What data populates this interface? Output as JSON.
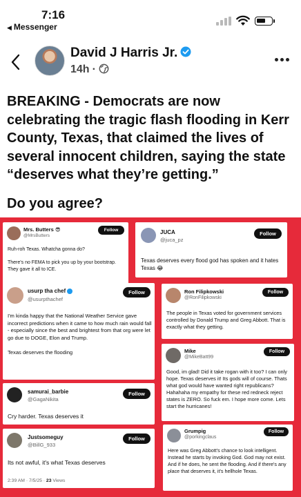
{
  "status_bar": {
    "time": "7:16",
    "back_app": "Messenger"
  },
  "post": {
    "author": "David J Harris Jr.",
    "time_ago": "14h",
    "text": "BREAKING - Democrats are now celebrating the tragic flash flooding in Kerr County, Texas, that claimed the lives of several innocent children, saying the state “deserves what they’re getting.”",
    "question": "Do you agree?"
  },
  "collage": {
    "follow_label": "Follow",
    "cards": [
      {
        "name": "Mrs. Butters 😎",
        "handle": "@MrsButters",
        "text": "Ruh-roh Texas. Whatcha gonna do?\n\nThere's no FEMA to pick you up by your bootstrap. They gave it all to ICE."
      },
      {
        "name": "JUCA",
        "handle": "@juca_pz",
        "text": "Texas deserves every flood god has spoken and it hates Texas 😂"
      },
      {
        "name": "usurp tha chef",
        "handle": "@usurpthachef",
        "text": "I'm kinda happy that the National Weather Service gave incorrect predictions when it came to how much rain would fall - especially since the best and brightest from that org were let go due to DOGE, Elon and Trump.\n\nTexas deserves the flooding"
      },
      {
        "name": "Ron Filipkowski",
        "handle": "@RonFilipkowski",
        "text": "The people in Texas voted for government services controlled by Donald Trump and Greg Abbott. That is exactly what they getting."
      },
      {
        "name": "Mike",
        "handle": "@MikeBatt99",
        "text": "Good, im glad! Did it take rogan with it too? I can only hope. Texas deserves it! Its gods will of course. Thats what god would have wanted right republicans? Hahahaha my empathy for these red redneck reject states is ZERO. So fuck em. I hope more come. Lets start the hurricanes!"
      },
      {
        "name": "samurai_barbie",
        "handle": "@GagaNikita",
        "text": "Cry harder. Texas deserves it"
      },
      {
        "name": "Justsomeguy",
        "handle": "@BillG_933",
        "text": "Its not awful, it's what Texas deserves",
        "footer_time": "2:39 AM · 7/5/25 · ",
        "footer_views": "23",
        "footer_views_label": " Views"
      },
      {
        "name": "Grumpig",
        "handle": "@porkingclaus",
        "text": "Here was Greg Abbott's chance to look intelligent. Instead he starts by invoking God. God may not exist. And if he does, he sent the flooding. And if there's any place that deserves it, it's hellhole Texas."
      }
    ]
  },
  "colors": {
    "collage_bg": "#e62a3a",
    "verified_blue": "#1d9bf0"
  },
  "icons": [
    "back-chevron-icon",
    "verified-icon",
    "globe-icon",
    "more-icon",
    "signal-icon",
    "wifi-icon",
    "battery-icon"
  ]
}
